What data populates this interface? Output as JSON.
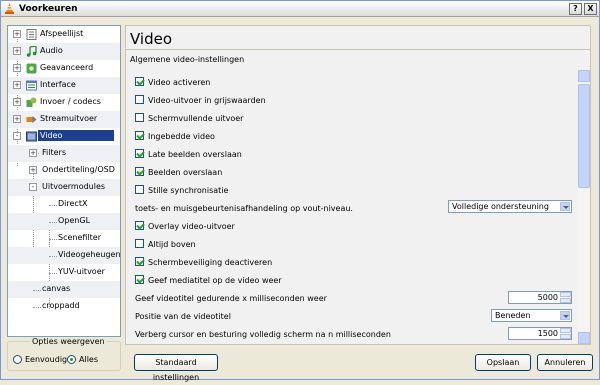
{
  "window": {
    "title": "Voorkeuren",
    "help_btn": "?",
    "close_btn": "X"
  },
  "sidebar": {
    "items": [
      {
        "label": "Afspeellijst",
        "icon": "playlist-icon"
      },
      {
        "label": "Audio",
        "icon": "music-note-icon"
      },
      {
        "label": "Geavanceerd",
        "icon": "gear-green-icon"
      },
      {
        "label": "Interface",
        "icon": "interface-icon"
      },
      {
        "label": "Invoer / codecs",
        "icon": "codec-icon"
      },
      {
        "label": "Streamuitvoer",
        "icon": "stream-icon"
      },
      {
        "label": "Video",
        "icon": "video-icon"
      },
      {
        "label": "Filters"
      },
      {
        "label": "Ondertiteling/OSD"
      },
      {
        "label": "Uitvoermodules"
      },
      {
        "label": "DirectX"
      },
      {
        "label": "OpenGL"
      },
      {
        "label": "Scenefilter"
      },
      {
        "label": "Videogeheugen"
      },
      {
        "label": "YUV-uitvoer"
      },
      {
        "label": "canvas"
      },
      {
        "label": "croppadd"
      }
    ],
    "expanders": {
      "collapsed": "+",
      "expanded": "-"
    }
  },
  "options": {
    "legend": "Opties weergeven",
    "simple": "Eenvoudig",
    "all": "Alles",
    "selected": "Alles"
  },
  "main": {
    "title": "Video",
    "subtitle": "Algemene video-instellingen",
    "checkboxes": [
      {
        "label": "Video activeren",
        "checked": true
      },
      {
        "label": "Video-uitvoer in grijswaarden",
        "checked": false
      },
      {
        "label": "Schermvullende uitvoer",
        "checked": false
      },
      {
        "label": "Ingebedde video",
        "checked": true
      },
      {
        "label": "Late beelden overslaan",
        "checked": true
      },
      {
        "label": "Beelden overslaan",
        "checked": true
      },
      {
        "label": "Stille synchronisatie",
        "checked": false
      }
    ],
    "hotkey_label": "toets- en muisgebeurtenisafhandeling op vout-niveau.",
    "hotkey_value": "Volledige ondersteuning",
    "checkboxes2": [
      {
        "label": "Overlay video-uitvoer",
        "checked": true
      },
      {
        "label": "Altijd boven",
        "checked": false
      },
      {
        "label": "Schermbeveiliging deactiveren",
        "checked": true
      },
      {
        "label": "Geef mediatitel op de video weer",
        "checked": true
      }
    ],
    "title_timeout_label": "Geef videotitel gedurende x milliseconden weer",
    "title_timeout_value": "5000",
    "title_position_label": "Positie van de videotitel",
    "title_position_value": "Beneden",
    "hide_cursor_label": "Verberg cursor en besturing volledig scherm na n milliseconden",
    "hide_cursor_value": "1500"
  },
  "buttons": {
    "reset": "Standaard instellingen",
    "save": "Opslaan",
    "cancel": "Annuleren"
  }
}
